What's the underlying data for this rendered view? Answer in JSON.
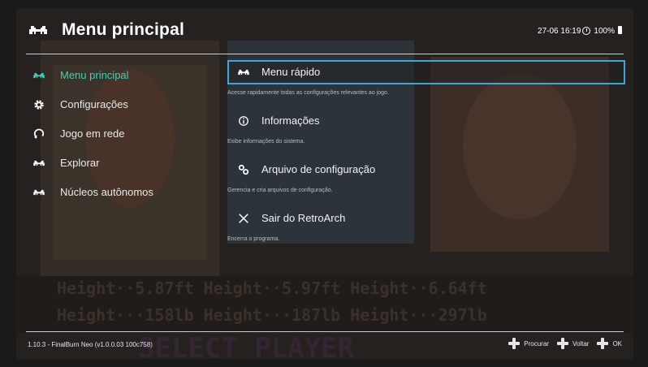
{
  "header": {
    "title": "Menu principal",
    "datetime": "27-06 16:19",
    "battery": "100%"
  },
  "sidebar": {
    "items": [
      {
        "label": "Menu principal",
        "icon": "invader-icon",
        "active": true
      },
      {
        "label": "Configurações",
        "icon": "gear-icon",
        "active": false
      },
      {
        "label": "Jogo em rede",
        "icon": "netplay-icon",
        "active": false
      },
      {
        "label": "Explorar",
        "icon": "invader-icon",
        "active": false
      },
      {
        "label": "Núcleos autônomos",
        "icon": "invader-icon",
        "active": false
      }
    ]
  },
  "menu": {
    "entries": [
      {
        "label": "Menu rápido",
        "sublabel": "Acesse rapidamente todas as configurações relevantes ao jogo.",
        "icon": "invader-icon",
        "active": true
      },
      {
        "label": "Informações",
        "sublabel": "Exibe informações do sistema.",
        "icon": "info-icon",
        "active": false
      },
      {
        "label": "Arquivo de configuração",
        "sublabel": "Gerencia e cria arquivos de configuração.",
        "icon": "config-file-icon",
        "active": false
      },
      {
        "label": "Sair do RetroArch",
        "sublabel": "Encerra o programa.",
        "icon": "close-icon",
        "active": false
      }
    ]
  },
  "footer": {
    "version": "1.10.3 - FinalBurn Neo (v1.0.0.03 100c758)",
    "hints": {
      "search": "Procurar",
      "back": "Voltar",
      "ok": "OK"
    }
  },
  "colors": {
    "accent": "#3fd1b6",
    "selection_border": "#3fa6d6"
  }
}
